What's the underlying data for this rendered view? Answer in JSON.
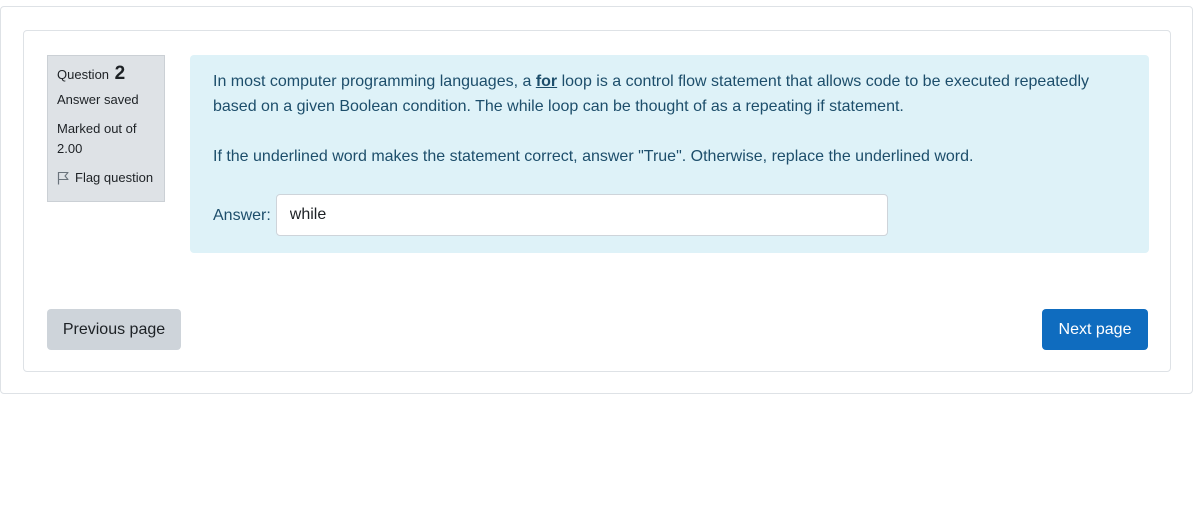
{
  "question_info": {
    "label": "Question",
    "number": "2",
    "state": "Answer saved",
    "grade": "Marked out of 2.00",
    "flag_label": "Flag question"
  },
  "question": {
    "text_before": "In most computer programming languages, a ",
    "underlined_word": "for",
    "text_after": " loop is a control flow statement that allows code to be executed repeatedly based on a given Boolean condition. The while loop can be thought of as a repeating if statement.",
    "instruction": "If the underlined word makes the statement correct, answer \"True\". Otherwise, replace the underlined word."
  },
  "answer": {
    "label": "Answer:",
    "value": "while"
  },
  "navigation": {
    "previous_label": "Previous page",
    "next_label": "Next page"
  },
  "colors": {
    "formulation_bg": "#def2f8",
    "info_bg": "#dee2e6",
    "primary": "#0f6cbf",
    "secondary": "#ced4da"
  },
  "icons": {
    "flag": "flag-icon"
  }
}
